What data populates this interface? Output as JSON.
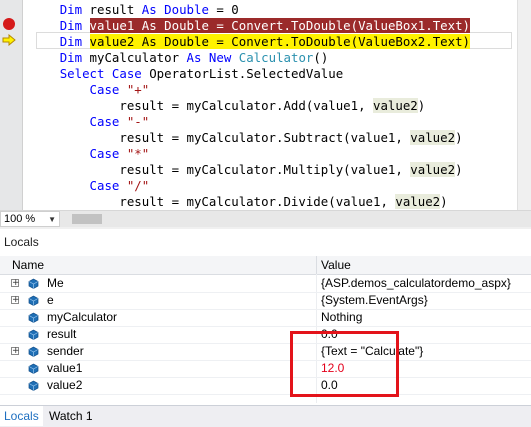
{
  "editor": {
    "lines": [
      [
        {
          "t": "        "
        },
        {
          "t": "Dim",
          "c": "kw"
        },
        {
          "t": " result "
        },
        {
          "t": "As",
          "c": "kw"
        },
        {
          "t": " "
        },
        {
          "t": "Double",
          "c": "kw"
        },
        {
          "t": " = 0"
        }
      ],
      [
        {
          "t": "        "
        },
        {
          "t": "Dim",
          "c": "kw"
        },
        {
          "t": " "
        },
        {
          "t": "value1 As Double = Convert.ToDouble(ValueBox1.Text)",
          "c": "bp"
        }
      ],
      [
        {
          "t": "        "
        },
        {
          "t": "Dim",
          "c": "kw"
        },
        {
          "t": " "
        },
        {
          "t": "value2 As Double = Convert.ToDouble(ValueBox2.Text)",
          "c": "cur"
        }
      ],
      [
        {
          "t": "        "
        },
        {
          "t": "Dim",
          "c": "kw"
        },
        {
          "t": " myCalculator "
        },
        {
          "t": "As",
          "c": "kw"
        },
        {
          "t": " "
        },
        {
          "t": "New",
          "c": "kw"
        },
        {
          "t": " "
        },
        {
          "t": "Calculator",
          "c": "typ"
        },
        {
          "t": "()"
        }
      ],
      [
        {
          "t": "        "
        },
        {
          "t": "Select",
          "c": "kw"
        },
        {
          "t": " "
        },
        {
          "t": "Case",
          "c": "kw"
        },
        {
          "t": " OperatorList.SelectedValue"
        }
      ],
      [
        {
          "t": "            "
        },
        {
          "t": "Case",
          "c": "kw"
        },
        {
          "t": " "
        },
        {
          "t": "\"+\"",
          "c": "str"
        }
      ],
      [
        {
          "t": "                result = myCalculator.Add(value1, "
        },
        {
          "t": "value2",
          "c": "hl"
        },
        {
          "t": ")"
        }
      ],
      [
        {
          "t": "            "
        },
        {
          "t": "Case",
          "c": "kw"
        },
        {
          "t": " "
        },
        {
          "t": "\"-\"",
          "c": "str"
        }
      ],
      [
        {
          "t": "                result = myCalculator.Subtract(value1, "
        },
        {
          "t": "value2",
          "c": "hl"
        },
        {
          "t": ")"
        }
      ],
      [
        {
          "t": "            "
        },
        {
          "t": "Case",
          "c": "kw"
        },
        {
          "t": " "
        },
        {
          "t": "\"*\"",
          "c": "str"
        }
      ],
      [
        {
          "t": "                result = myCalculator.Multiply(value1, "
        },
        {
          "t": "value2",
          "c": "hl"
        },
        {
          "t": ")"
        }
      ],
      [
        {
          "t": "            "
        },
        {
          "t": "Case",
          "c": "kw"
        },
        {
          "t": " "
        },
        {
          "t": "\"/\"",
          "c": "str"
        }
      ],
      [
        {
          "t": "                result = myCalculator.Divide(value1, "
        },
        {
          "t": "value2",
          "c": "hl"
        },
        {
          "t": ")"
        }
      ]
    ],
    "zoom": "100 %"
  },
  "locals": {
    "title": "Locals",
    "col_name": "Name",
    "col_value": "Value",
    "rows": [
      {
        "name": "Me",
        "value": "{ASP.demos_calculatordemo_aspx}",
        "expandable": true,
        "changed": false
      },
      {
        "name": "e",
        "value": "{System.EventArgs}",
        "expandable": true,
        "changed": false
      },
      {
        "name": "myCalculator",
        "value": "Nothing",
        "expandable": false,
        "changed": false
      },
      {
        "name": "result",
        "value": "0.0",
        "expandable": false,
        "changed": false
      },
      {
        "name": "sender",
        "value": "{Text = \"Calculate\"}",
        "expandable": true,
        "changed": false
      },
      {
        "name": "value1",
        "value": "12.0",
        "expandable": false,
        "changed": true
      },
      {
        "name": "value2",
        "value": "0.0",
        "expandable": false,
        "changed": false
      }
    ]
  },
  "tabs": [
    {
      "label": "Locals",
      "active": true
    },
    {
      "label": "Watch 1",
      "active": false
    }
  ],
  "colors": {
    "breakpoint": "#d51a1a",
    "current_line": "#fff200",
    "changed_value": "#e3001b",
    "annotation_box": "#e3131a",
    "active_tab": "#1e6fc0"
  },
  "icons": {
    "breakpoint": "breakpoint-icon",
    "execution_pointer": "current-statement-arrow-icon",
    "field": "field-icon",
    "expand": "expand-plus-icon"
  }
}
